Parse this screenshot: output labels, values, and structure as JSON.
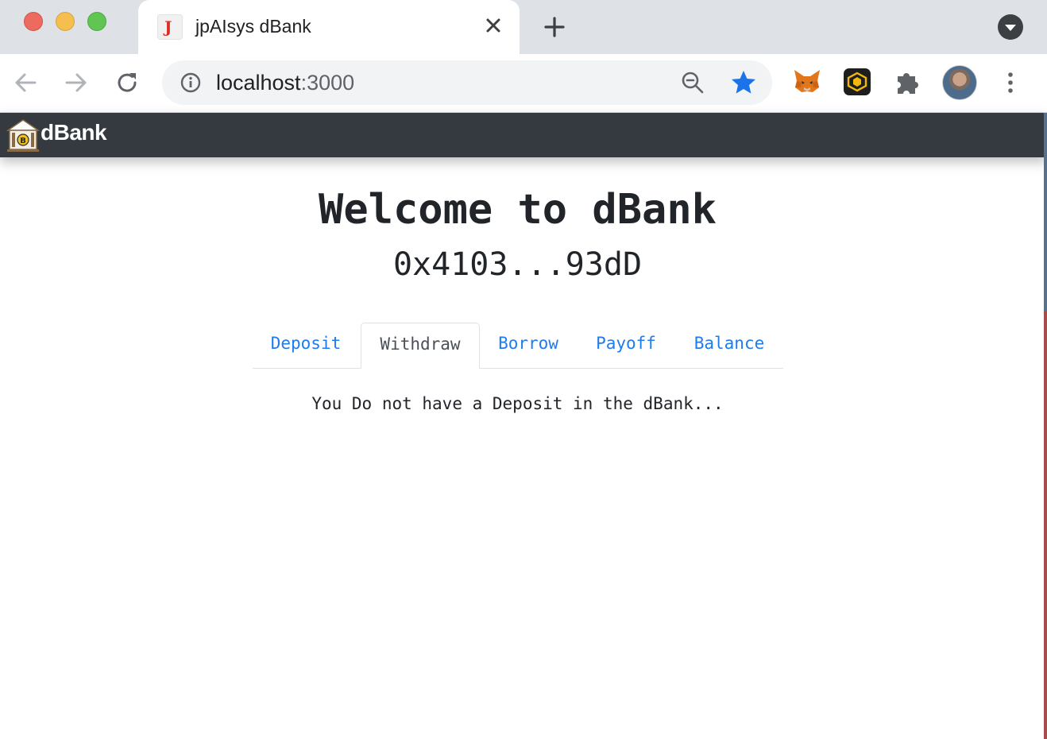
{
  "browser": {
    "tab_title": "jpAIsys dBank",
    "favicon_letter": "J",
    "url_host": "localhost",
    "url_port": ":3000"
  },
  "navbar": {
    "brand": "dBank",
    "bg_color": "#343a40"
  },
  "main": {
    "heading": "Welcome to dBank",
    "account": "0x4103...93dD",
    "tabs": [
      {
        "label": "Deposit",
        "active": false
      },
      {
        "label": "Withdraw",
        "active": true
      },
      {
        "label": "Borrow",
        "active": false
      },
      {
        "label": "Payoff",
        "active": false
      },
      {
        "label": "Balance",
        "active": false
      }
    ],
    "message": "You Do not have a Deposit in the dBank..."
  },
  "colors": {
    "link": "#1f7bf0",
    "active_tab_text": "#495057",
    "bookmark_star": "#1a73e8"
  },
  "icons": {
    "extensions": [
      "metamask-fox-icon",
      "binance-wallet-icon",
      "puzzle-piece-icon"
    ]
  }
}
